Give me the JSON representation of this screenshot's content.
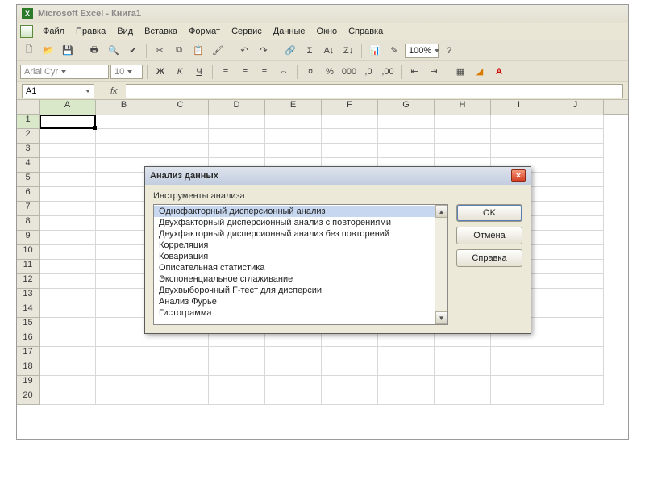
{
  "title": "Microsoft Excel - Книга1",
  "menu": {
    "file": "Файл",
    "edit": "Правка",
    "view": "Вид",
    "insert": "Вставка",
    "format": "Формат",
    "tools": "Сервис",
    "data": "Данные",
    "window": "Окно",
    "help": "Справка"
  },
  "toolbar": {
    "zoom": "100%",
    "font": "Arial Cyr",
    "size": "10",
    "bold": "Ж",
    "italic": "К",
    "underline": "Ч"
  },
  "namebox": "A1",
  "fx_label": "fx",
  "columns": [
    "A",
    "B",
    "C",
    "D",
    "E",
    "F",
    "G",
    "H",
    "I",
    "J"
  ],
  "rows": [
    "1",
    "2",
    "3",
    "4",
    "5",
    "6",
    "7",
    "8",
    "9",
    "10",
    "11",
    "12",
    "13",
    "14",
    "15",
    "16",
    "17",
    "18",
    "19",
    "20"
  ],
  "dialog": {
    "title": "Анализ данных",
    "list_label": "Инструменты анализа",
    "items": [
      "Однофакторный дисперсионный анализ",
      "Двухфакторный дисперсионный анализ с повторениями",
      "Двухфакторный дисперсионный анализ без повторений",
      "Корреляция",
      "Ковариация",
      "Описательная статистика",
      "Экспоненциальное сглаживание",
      "Двухвыборочный F-тест для дисперсии",
      "Анализ Фурье",
      "Гистограмма"
    ],
    "selected_index": 0,
    "ok": "OK",
    "cancel": "Отмена",
    "help": "Справка"
  }
}
